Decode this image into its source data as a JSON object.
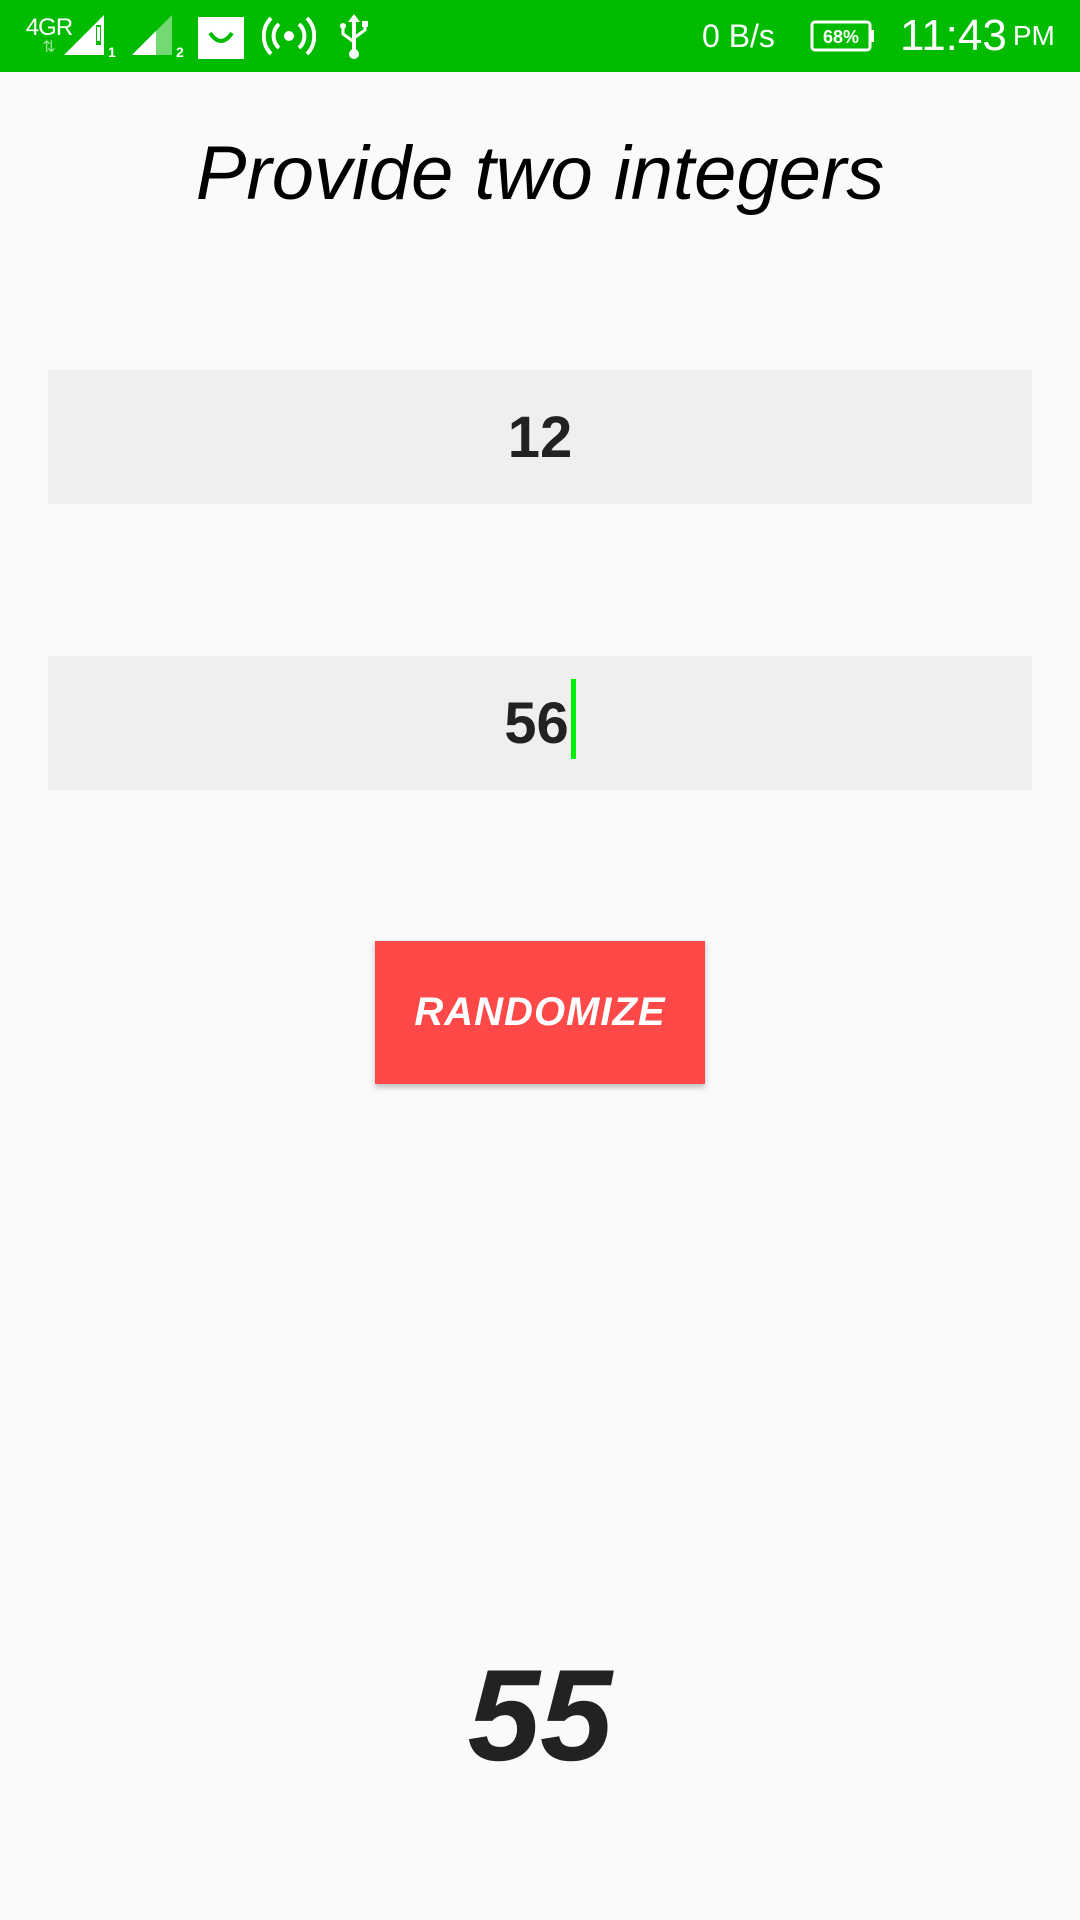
{
  "status_bar": {
    "network_type": "4GR",
    "net_speed": "0 B/s",
    "battery": "68%",
    "time": "11:43",
    "ampm": "PM",
    "icons": [
      "data-arrows-icon",
      "signal-sim1-icon",
      "signal-sim2-icon",
      "shopping-bag-icon",
      "hotspot-icon",
      "usb-icon",
      "battery-icon"
    ],
    "color": "#00bb00"
  },
  "main": {
    "title": "Provide two integers",
    "input_min": {
      "value": "12"
    },
    "input_max": {
      "value": "56"
    },
    "randomize_label": "RANDOMIZE",
    "result": "55",
    "accent_color": "#ff4848",
    "cursor_color": "#00ee00"
  }
}
